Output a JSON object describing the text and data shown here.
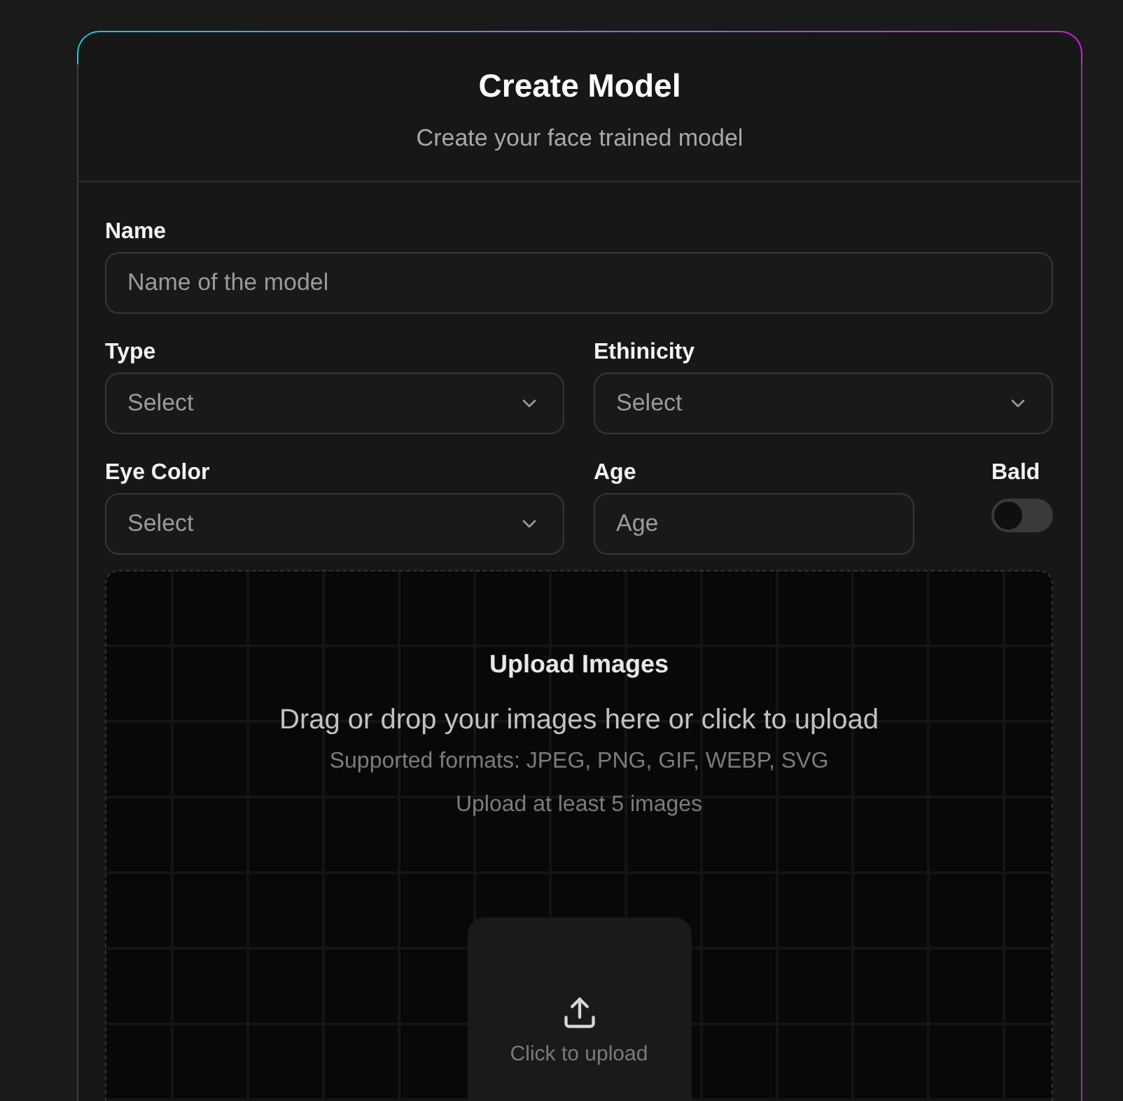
{
  "header": {
    "title": "Create Model",
    "subtitle": "Create your face trained model"
  },
  "rows": [
    [
      {
        "kind": "text",
        "label": "Name",
        "placeholder": "Name of the model"
      }
    ],
    [
      {
        "kind": "select",
        "label": "Type",
        "placeholder": "Select"
      },
      {
        "kind": "select",
        "label": "Ethinicity",
        "placeholder": "Select"
      }
    ],
    [
      {
        "kind": "select",
        "label": "Eye Color",
        "placeholder": "Select"
      },
      {
        "kind": "text",
        "label": "Age",
        "placeholder": "Age"
      },
      {
        "kind": "switch",
        "label": "Bald",
        "on": false
      }
    ]
  ],
  "upload": {
    "title": "Upload Images",
    "instruction": "Drag or drop your images here or click to upload",
    "formats": "Supported formats: JPEG, PNG, GIF, WEBP, SVG",
    "requirement": "Upload at least 5 images",
    "button": "Click to upload"
  }
}
